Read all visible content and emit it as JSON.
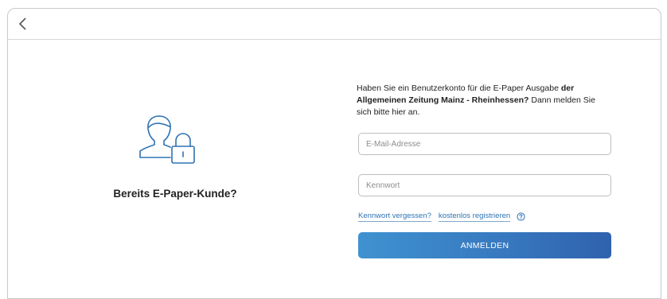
{
  "header": {
    "back_icon": "chevron-left-icon"
  },
  "left": {
    "icon": "user-lock-icon",
    "headline": "Bereits E-Paper-Kunde?"
  },
  "form": {
    "intro_part1": "Haben Sie ein Benutzerkonto für die E-Paper Ausgabe ",
    "intro_bold": "der Allgemeinen Zeitung Mainz - Rheinhessen?",
    "intro_part2": " Dann melden Sie sich bitte hier an.",
    "email_placeholder": "E-Mail-Adresse",
    "email_value": "",
    "password_placeholder": "Kennwort",
    "password_value": "",
    "forgot_link": "Kennwort vergessen?",
    "register_link": "kostenlos registrieren",
    "help_icon": "help-circle-icon",
    "submit_label": "ANMELDEN"
  },
  "colors": {
    "accent": "#3777be",
    "link": "#2f73b3",
    "icon_stroke": "#2f73b3"
  }
}
